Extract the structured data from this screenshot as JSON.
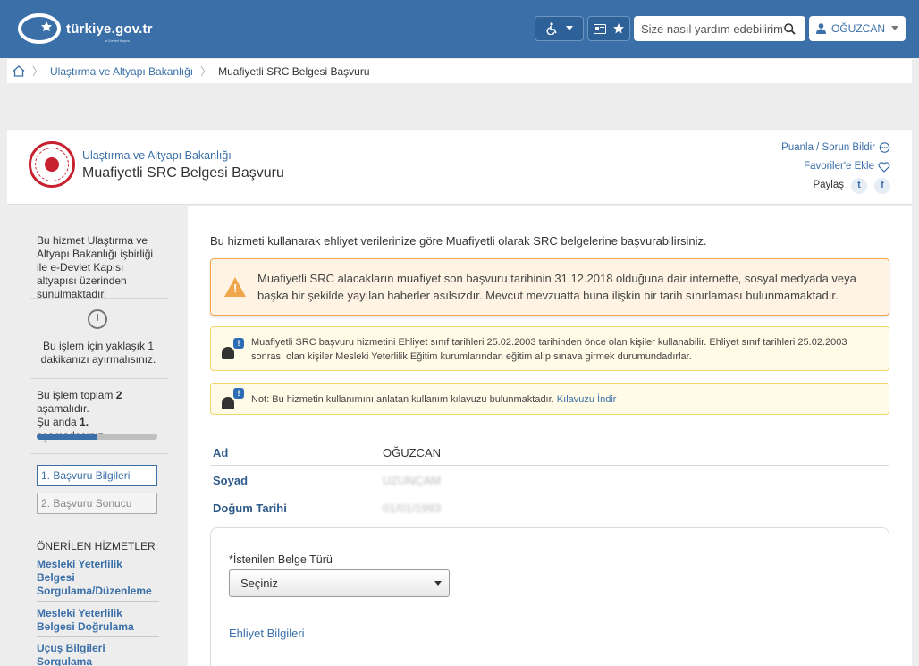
{
  "header": {
    "logo_text": "türkiye.gov.tr",
    "logo_sub": "e-Devlet Kapısı",
    "search_placeholder": "Size nasıl yardım edebilirim?",
    "user_name": "OĞUZCAN"
  },
  "breadcrumb": {
    "items": [
      "Ulaştırma ve Altyapı Bakanlığı",
      "Muafiyetli SRC Belgesi Başvuru"
    ]
  },
  "service": {
    "ministry": "Ulaştırma ve Altyapı Bakanlığı",
    "title": "Muafiyetli SRC Belgesi Başvuru",
    "rate_label": "Puanla / Sorun Bildir",
    "favorite_label": "Favoriler'e Ekle",
    "share_label": "Paylaş"
  },
  "sidebar": {
    "about": "Bu hizmet Ulaştırma ve Altyapı Bakanlığı işbirliği ile e-Devlet Kapısı altyapısı üzerinden sunulmaktadır.",
    "time_note": "Bu işlem için yaklaşık 1 dakikanızı ayırmalısınız.",
    "steps_line1": "Bu işlem toplam ",
    "steps_total": "2",
    "steps_line2": "aşamalıdır.",
    "current_line1": "Şu anda ",
    "current_step": "1.",
    "current_line2": " aşamadasınız.",
    "progress_fraction": 0.5,
    "steps": [
      "1. Başvuru Bilgileri",
      "2. Başvuru Sonucu"
    ],
    "recommended_title": "ÖNERİLEN HİZMETLER",
    "recommended": [
      "Mesleki Yeterlilik Belgesi Sorgulama/Düzenleme",
      "Mesleki Yeterlilik Belgesi Doğrulama",
      "Uçuş Bilgileri Sorgulama"
    ]
  },
  "main": {
    "intro": "Bu hizmeti kullanarak ehliyet verilerinize göre Muafiyetli olarak SRC belgelerine başvurabilirsiniz.",
    "warning": "Muafiyetli SRC alacakların muafiyet son başvuru tarihinin 31.12.2018 olduğuna dair internette, sosyal medyada veya başka bir şekilde yayılan haberler asılsızdır. Mevcut mevzuatta buna ilişkin bir tarih sınırlaması bulunmamaktadır.",
    "info1": "Muafiyetli SRC başvuru hizmetini Ehliyet sınıf tarihleri 25.02.2003 tarihinden önce olan kişiler kullanabilir. Ehliyet sınıf tarihleri 25.02.2003 sonrası olan kişiler Mesleki Yeterlilik Eğitim kurumlarından eğitim alıp sınava girmek durumundadırlar.",
    "info2_text": "Not: Bu hizmetin kullanımını anlatan kullanım kılavuzu bulunmaktadır. ",
    "info2_link": "Kılavuzu İndir",
    "fields": [
      {
        "label": "Ad",
        "value": "OĞUZCAN"
      },
      {
        "label": "Soyad",
        "value": "UZUNÇAM"
      },
      {
        "label": "Doğum Tarihi",
        "value": "01/01/1993"
      }
    ],
    "form": {
      "doc_type_label": "*İstenilen Belge Türü",
      "doc_type_value": "Seçiniz",
      "license_section": "Ehliyet Bilgileri"
    }
  },
  "colors": {
    "brand": "#3a6fa8",
    "warning": "#f0a64b",
    "info_bg": "#fffbe6"
  }
}
